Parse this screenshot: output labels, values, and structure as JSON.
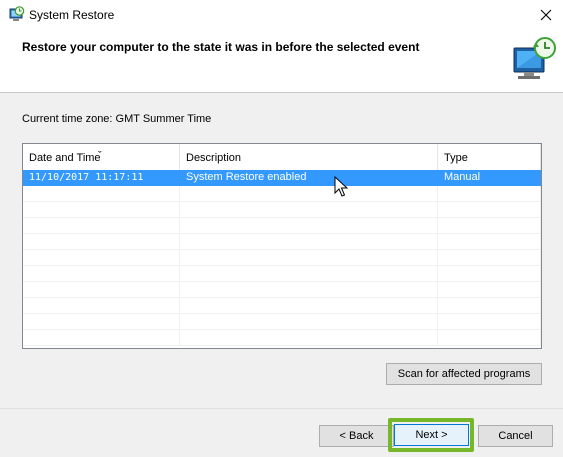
{
  "window": {
    "title": "System Restore",
    "close_symbol": "✕"
  },
  "header": {
    "title": "Restore your computer to the state it was in before the selected event"
  },
  "timezone": {
    "label": "Current time zone: GMT Summer Time"
  },
  "list": {
    "columns": [
      "Date and Time",
      "Description",
      "Type"
    ],
    "sorted_column_glyph": "ˇ",
    "rows": [
      {
        "date": "11/10/2017 11:17:11",
        "description": "System Restore enabled",
        "type": "Manual",
        "selected": true
      }
    ]
  },
  "buttons": {
    "scan": "Scan for affected programs",
    "back": "< Back",
    "next": "Next >",
    "cancel": "Cancel"
  },
  "colors": {
    "selection": "#3399ff",
    "highlight": "#76b82a"
  }
}
